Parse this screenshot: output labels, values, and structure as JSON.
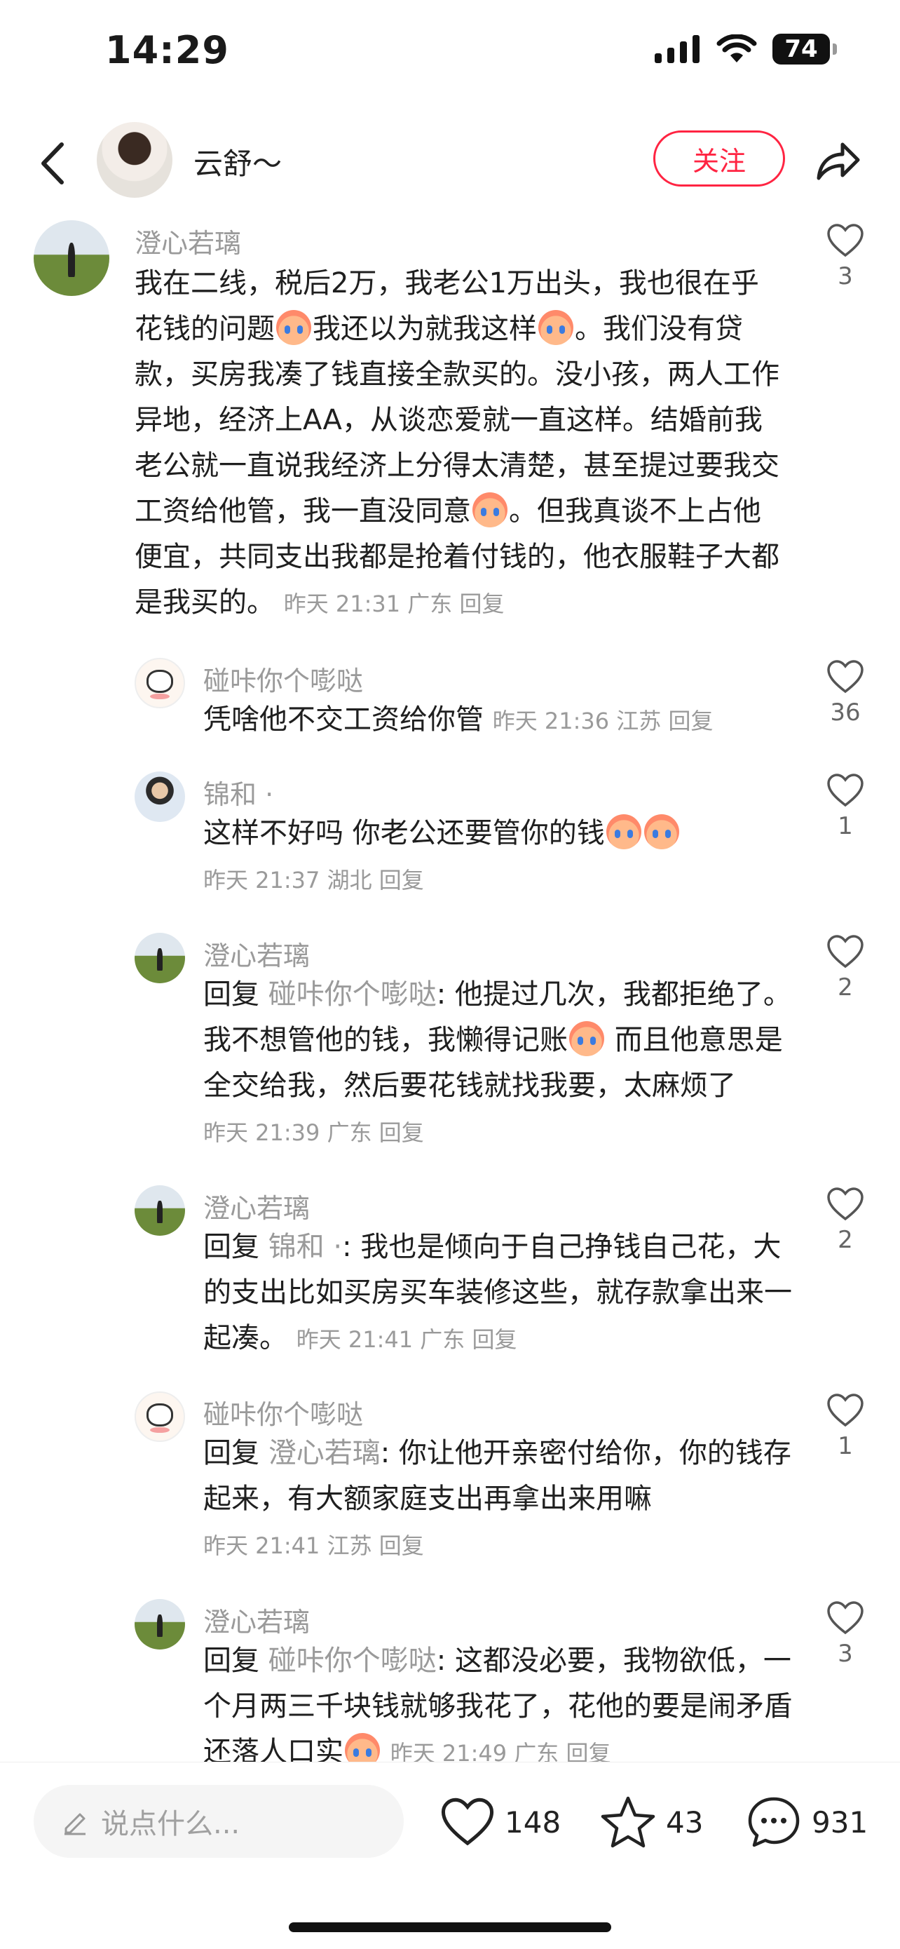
{
  "status_bar": {
    "time": "14:29",
    "battery": "74"
  },
  "header": {
    "author_name": "云舒～",
    "follow_label": "关注"
  },
  "comments": [
    {
      "name": "澄心若璃",
      "segments": [
        "我在二线，税后2万，我老公1万出头，我也很在乎花钱的问题",
        "我还以为就我这样",
        "。我们没有贷款，买房我凑了钱直接全款买的。没小孩，两人工作异地，经济上AA，从谈恋爱就一直这样。结婚前我老公就一直说我经济上分得太清楚，甚至提过要我交工资给他管，我一直没同意",
        "。但我真谈不上占他便宜，共同支出我都是抢着付钱的，他衣服鞋子大都是我买的。"
      ],
      "meta": "昨天 21:31 广东 回复",
      "likes": "3"
    },
    {
      "name": "碰咔你个嘭哒",
      "body": "凭啥他不交工资给你管",
      "meta": "昨天 21:36 江苏 回复",
      "likes": "36"
    },
    {
      "name": "锦和 ·",
      "body": "这样不好吗  你老公还要管你的钱",
      "meta": "昨天 21:37 湖北 回复",
      "likes": "1"
    },
    {
      "name": "澄心若璃",
      "reply_prefix": "回复",
      "reply_target": "碰咔你个嘭哒",
      "body_a": ": 他提过几次，我都拒绝了。我不想管他的钱，我懒得记账",
      "body_b": " 而且他意思是全交给我，然后要花钱就找我要，太麻烦了",
      "meta": "昨天 21:39 广东 回复",
      "likes": "2"
    },
    {
      "name": "澄心若璃",
      "reply_prefix": "回复",
      "reply_target": "锦和 ·",
      "body": ": 我也是倾向于自己挣钱自己花，大的支出比如买房买车装修这些，就存款拿出来一起凑。",
      "meta": "昨天 21:41 广东 回复",
      "likes": "2"
    },
    {
      "name": "碰咔你个嘭哒",
      "reply_prefix": "回复",
      "reply_target": "澄心若璃",
      "body": ": 你让他开亲密付给你，你的钱存起来，有大额家庭支出再拿出来用嘛",
      "meta": "昨天 21:41 江苏 回复",
      "likes": "1"
    },
    {
      "name": "澄心若璃",
      "reply_prefix": "回复",
      "reply_target": "碰咔你个嘭哒",
      "body": ": 这都没必要，我物欲低，一个月两三千块钱就够我花了，花他的要是闹矛盾还落人口实",
      "meta": "昨天 21:49 广东 回复",
      "likes": "3"
    }
  ],
  "bottom_bar": {
    "input_placeholder": "说点什么...",
    "like_count": "148",
    "collect_count": "43",
    "comment_count": "931"
  },
  "colors": {
    "accent": "#ff2442",
    "muted": "#9a9a9a"
  }
}
